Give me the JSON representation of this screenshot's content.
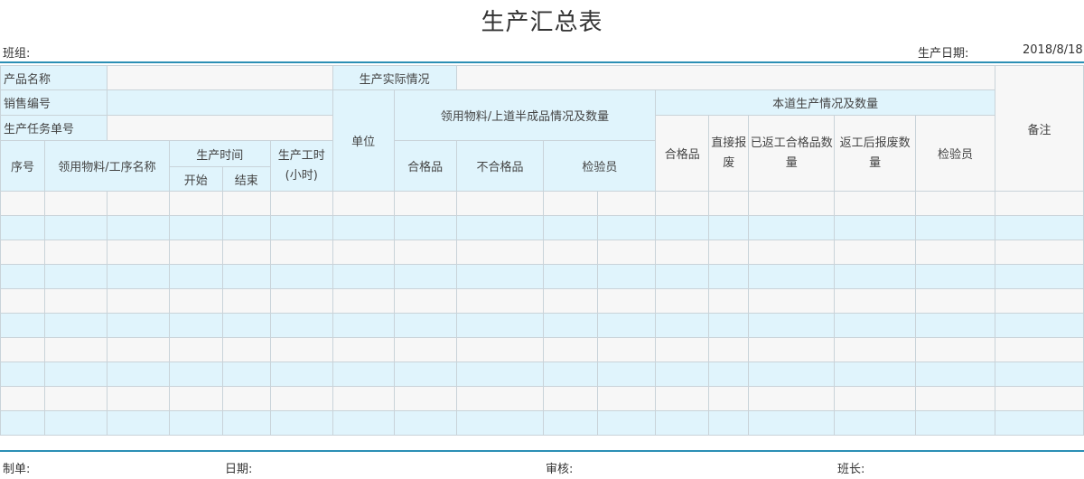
{
  "title": "生产汇总表",
  "header": {
    "team_label": "班组:",
    "date_label": "生产日期:",
    "date_value": "2018/8/18"
  },
  "info": {
    "product_name": "产品名称",
    "actual": "生产实际情况",
    "sales_no": "销售编号",
    "task_no": "生产任务单号",
    "remarks": "备注"
  },
  "columns": {
    "unit": "单位",
    "materials_group": "领用物料/上道半成品情况及数量",
    "current_group": "本道生产情况及数量",
    "seq": "序号",
    "material_name": "领用物料/工序名称",
    "prod_time": "生产时间",
    "start": "开始",
    "end": "结束",
    "work_hours": "生产工时",
    "hours_unit": "(小时)",
    "qualified": "合格品",
    "unqualified": "不合格品",
    "inspector": "检验员",
    "qualified2": "合格品",
    "direct_scrap_1": "直接报",
    "direct_scrap_2": "废",
    "rework_ok_1": "已返工合格品数",
    "rework_ok_2": "量",
    "rework_scrap_1": "返工后报废数",
    "rework_scrap_2": "量",
    "inspector2": "检验员"
  },
  "footer": {
    "maker": "制单:",
    "date": "日期:",
    "review": "审核:",
    "leader": "班长:"
  }
}
